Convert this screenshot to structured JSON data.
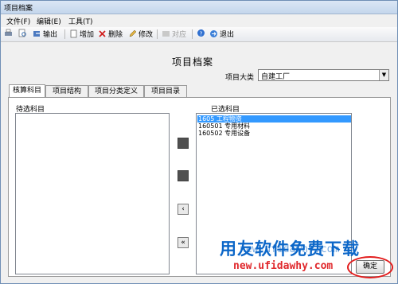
{
  "window": {
    "title": "项目档案"
  },
  "menu": {
    "file": "文件(F)",
    "edit": "编辑(E)",
    "tools": "工具(T)"
  },
  "toolbar": {
    "output": "输出",
    "add": "增加",
    "delete": "删除",
    "modify": "修改",
    "align": "对应",
    "exit": "退出",
    "align_enabled": false
  },
  "main": {
    "heading": "项目档案",
    "category_label": "项目大类",
    "category_value": "自建工厂"
  },
  "tabs": [
    "核算科目",
    "项目结构",
    "项目分类定义",
    "项目目录"
  ],
  "subjects": {
    "pending_label": "待选科目",
    "pending_items": [],
    "selected_label": "已选科目",
    "selected_items": [
      {
        "code": "1605",
        "name": "工程物资",
        "selected": true
      },
      {
        "code": "160501",
        "name": "专用材料",
        "selected": false
      },
      {
        "code": "160502",
        "name": "专用设备",
        "selected": false
      }
    ]
  },
  "buttons": {
    "ok": "确定"
  },
  "watermark": {
    "line1": "用友软件免费下载",
    "line2": "new.ufidawhy.com",
    "line3": "new.ufidawhy.com"
  },
  "colors": {
    "selection": "#3399ff",
    "watermark_blue": "#0b66c8",
    "watermark_red": "#e0282c"
  }
}
